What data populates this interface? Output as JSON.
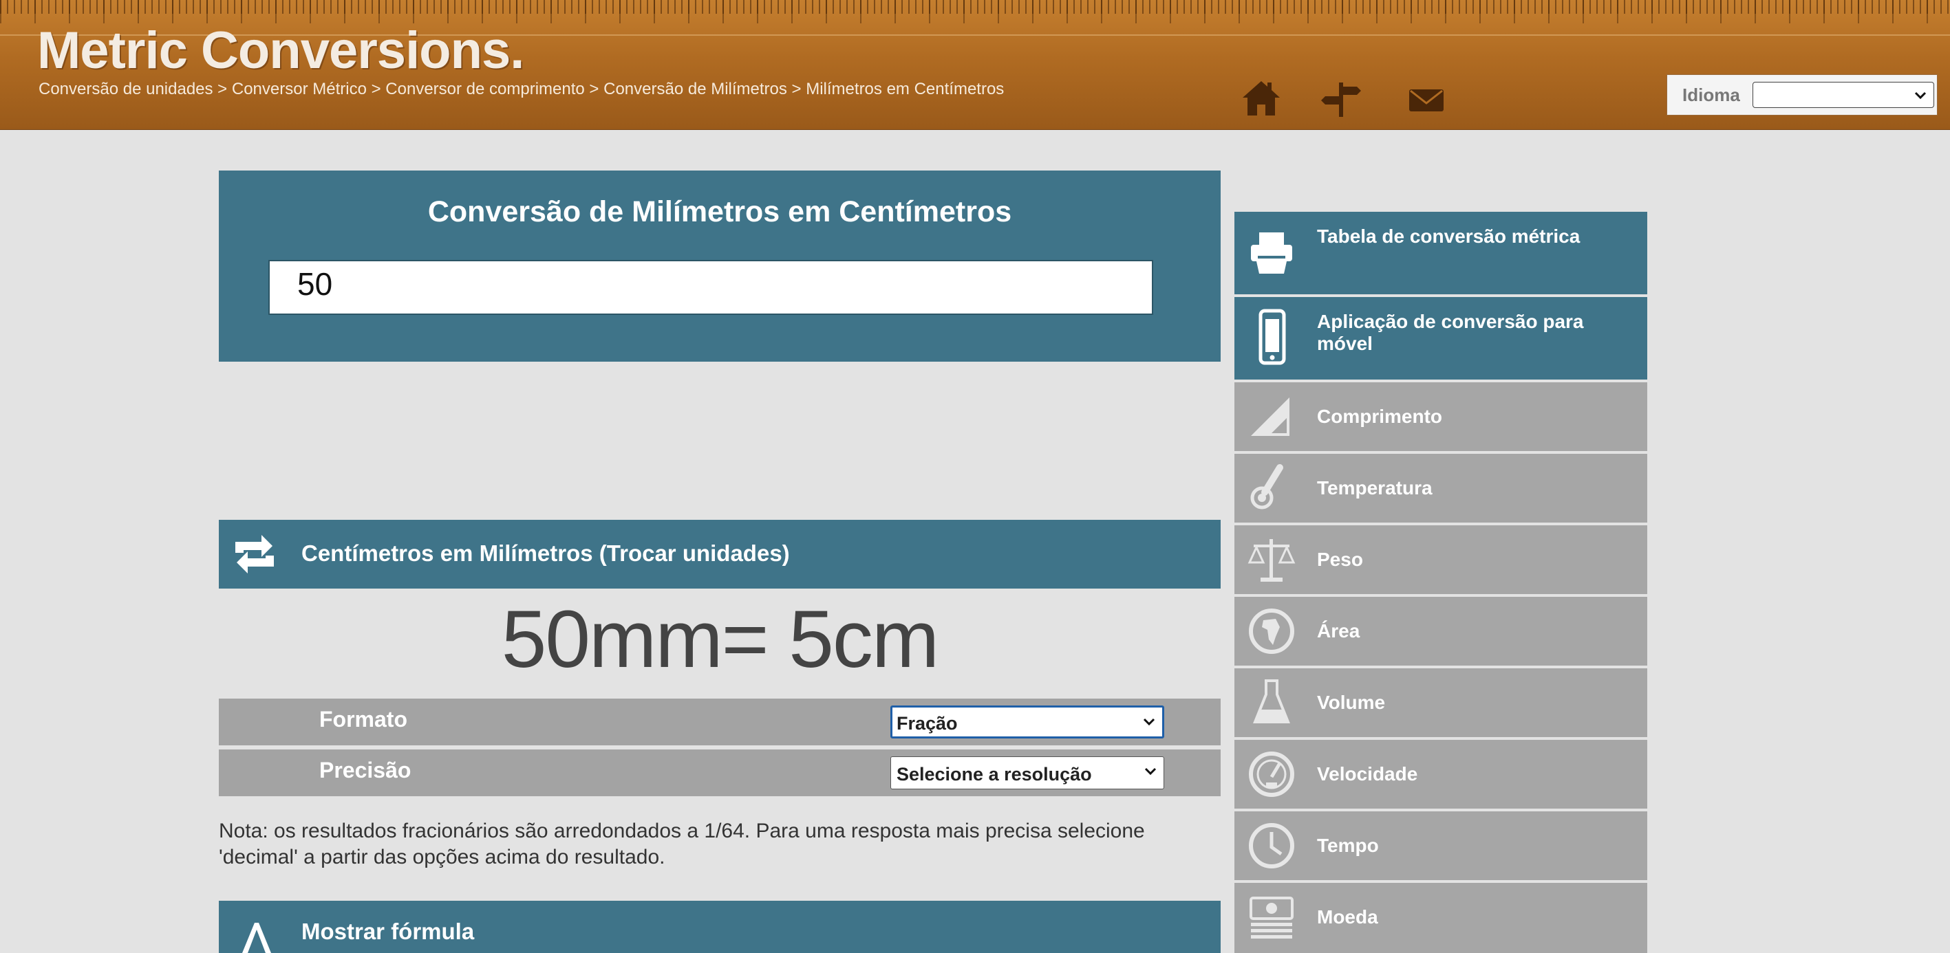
{
  "header": {
    "logo": "Metric Conversions.",
    "breadcrumb": [
      "Conversão de unidades",
      "Conversor Métrico",
      "Conversor de comprimento",
      "Conversão de Milímetros",
      "Milímetros em Centímetros"
    ],
    "breadcrumb_separator": " > ",
    "icons": [
      "home-icon",
      "signpost-icon",
      "envelope-icon"
    ],
    "language_label": "Idioma",
    "language_value": ""
  },
  "converter": {
    "title": "Conversão de Milímetros em Centímetros",
    "input_value": "50"
  },
  "swap": {
    "label": "Centímetros em Milímetros (Trocar unidades)"
  },
  "result": "50mm= 5cm",
  "options": {
    "format_label": "Formato",
    "format_value": "Fração",
    "precision_label": "Precisão",
    "precision_value": "Selecione a resolução"
  },
  "note": "Nota: os resultados fracionários são arredondados a 1/64. Para uma resposta mais precisa selecione 'decimal' a partir das opções acima do resultado.",
  "formula": {
    "label": "Mostrar fórmula"
  },
  "sidebar": {
    "items": [
      {
        "label": "Tabela de conversão métrica",
        "icon": "printer-icon",
        "style": "blue"
      },
      {
        "label": "Aplicação de conversão para móvel",
        "icon": "mobile-phone-icon",
        "style": "blue"
      },
      {
        "label": "Comprimento",
        "icon": "ruler-triangle-icon",
        "style": "gray"
      },
      {
        "label": "Temperatura",
        "icon": "thermometer-icon",
        "style": "gray"
      },
      {
        "label": "Peso",
        "icon": "scales-icon",
        "style": "gray"
      },
      {
        "label": "Área",
        "icon": "globe-africa-icon",
        "style": "gray"
      },
      {
        "label": "Volume",
        "icon": "flask-icon",
        "style": "gray"
      },
      {
        "label": "Velocidade",
        "icon": "speedometer-icon",
        "style": "gray"
      },
      {
        "label": "Tempo",
        "icon": "clock-icon",
        "style": "gray"
      },
      {
        "label": "Moeda",
        "icon": "banknotes-icon",
        "style": "gray"
      }
    ]
  },
  "colors": {
    "header_brown": "#b06b22",
    "panel_teal": "#3f7489",
    "panel_gray": "#a6a6a6",
    "background": "#e3e3e3"
  }
}
